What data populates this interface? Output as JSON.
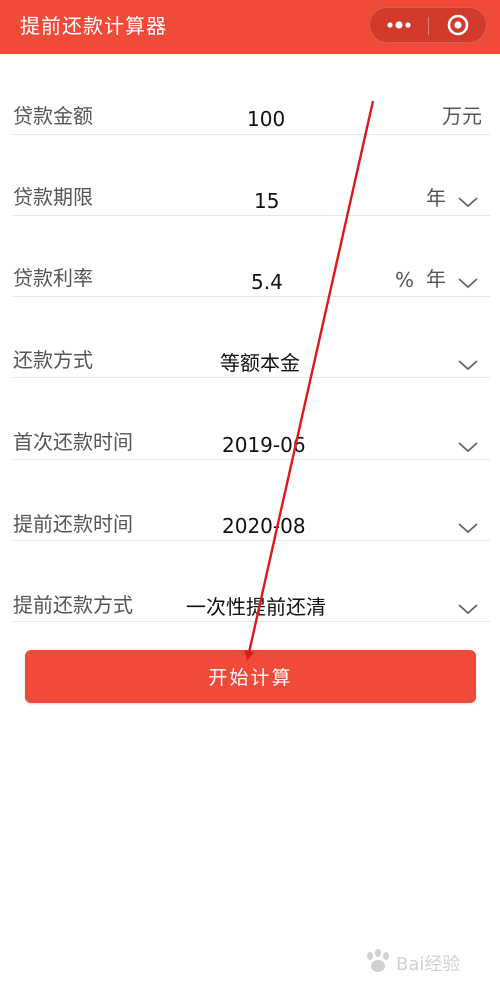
{
  "header": {
    "title": "提前还款计算器",
    "accent_color": "#ef4b38"
  },
  "capsule": {
    "more_icon": "more-dots-icon",
    "close_icon": "mini-program-close-icon"
  },
  "form": {
    "loan_amount": {
      "label": "贷款金额",
      "value": "100",
      "unit": "万元"
    },
    "loan_term": {
      "label": "贷款期限",
      "value": "15",
      "unit": "年"
    },
    "loan_rate": {
      "label": "贷款利率",
      "value": "5.4",
      "unit_percent": "%",
      "unit_year": "年"
    },
    "repay_method": {
      "label": "还款方式",
      "value": "等额本金"
    },
    "first_repay_time": {
      "label": "首次还款时间",
      "value": "2019-06"
    },
    "prepay_time": {
      "label": "提前还款时间",
      "value": "2020-08"
    },
    "prepay_method": {
      "label": "提前还款方式",
      "value": "一次性提前还清"
    }
  },
  "actions": {
    "start_label": "开始计算"
  },
  "annotation": {
    "arrow_color": "#e01818"
  },
  "watermark": {
    "text": "Bai经验"
  }
}
